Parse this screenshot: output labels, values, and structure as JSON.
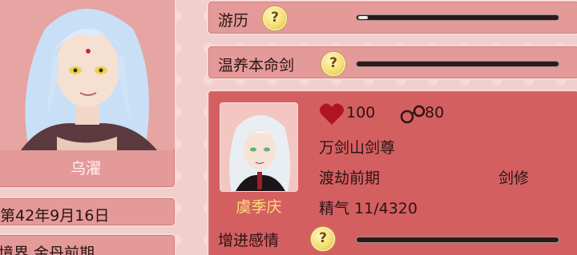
{
  "left": {
    "character_name": "乌濯",
    "date": "第42年9月16日",
    "realm": "境界 金丹前期"
  },
  "rows": [
    {
      "label": "游历",
      "help": "?",
      "progress": 0.05
    },
    {
      "label": "温养本命剑",
      "help": "?",
      "progress": 0.0
    }
  ],
  "card": {
    "name": "虞季庆",
    "hp": "100",
    "bond": "80",
    "title": "万剑山剑尊",
    "stage": "渡劫前期",
    "class": "剑修",
    "essence": "精气 11/4320",
    "action_label": "增进感情",
    "action_help": "?",
    "action_progress": 0.0
  },
  "colors": {
    "panel": "#e39a98",
    "card": "#d45f61",
    "gold_name": "#ffdd7a"
  },
  "icons": [
    "heart-icon",
    "handcuffs-icon",
    "question-icon"
  ]
}
